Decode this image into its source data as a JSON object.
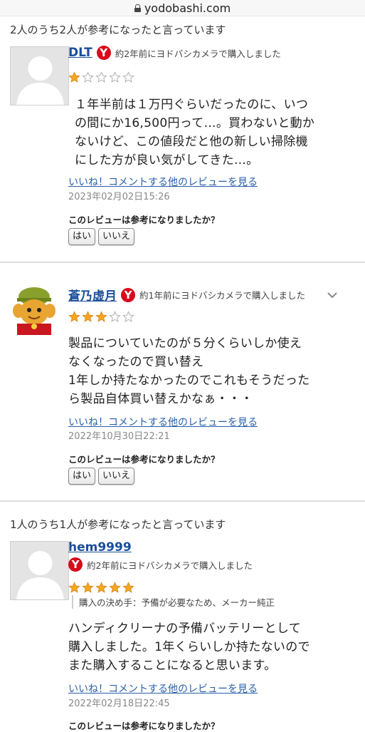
{
  "browser": {
    "domain": "yodobashi.com"
  },
  "reviews": [
    {
      "helpful": "2人のうち2人が参考になったと言っています",
      "username": "DLT",
      "badge": "Y",
      "purchase_info": "約2年前にヨドバシカメラで購入しました",
      "rating": 1,
      "body": [
        "１年半前は１万円ぐらいだったのに、いつ",
        "の間にか16,500円って…。買わないと動か",
        "ないけど、この値段だと他の新しい掃除機",
        "にした方が良い気がしてきた…。"
      ],
      "links": "いいね！コメントする他のレビューを見る",
      "date": "2023年02月02日15:26",
      "question": "このレビューは参考になりましたか？",
      "yes": "はい",
      "no": "いいえ"
    },
    {
      "username": "蒼乃虚月",
      "badge": "Y",
      "purchase_info": "約1年前にヨドバシカメラで購入しました",
      "rating": 3,
      "body": [
        "製品についていたのが５分くらいしか使え",
        "なくなったので買い替え",
        "1年しか持たなかったのでこれもそうだった",
        "ら製品自体買い替えかなぁ・・・"
      ],
      "links": "いいね！コメントする他のレビューを見る",
      "date": "2022年10月30日22:21",
      "question": "このレビューは参考になりましたか？",
      "yes": "はい",
      "no": "いいえ"
    },
    {
      "helpful": "1人のうち1人が参考になったと言っています",
      "username": "hem9999",
      "badge": "Y",
      "purchase_info": "約2年前にヨドバシカメラで購入しました",
      "rating": 5,
      "reason": "購入の決め手：予備が必要なため、メーカー純正",
      "body": [
        "ハンディクリーナの予備バッテリーとして",
        "購入しました。1年くらいしか持たないので",
        "また購入することになると思います。"
      ],
      "links": "いいね！コメントする他のレビューを見る",
      "date": "2022年02月18日22:45",
      "question": "このレビューは参考になりましたか？"
    }
  ],
  "colors": {
    "star_on": "#f5a623",
    "star_off": "#ffffff",
    "link": "#2a5fa8",
    "badge": "#d8091b"
  }
}
